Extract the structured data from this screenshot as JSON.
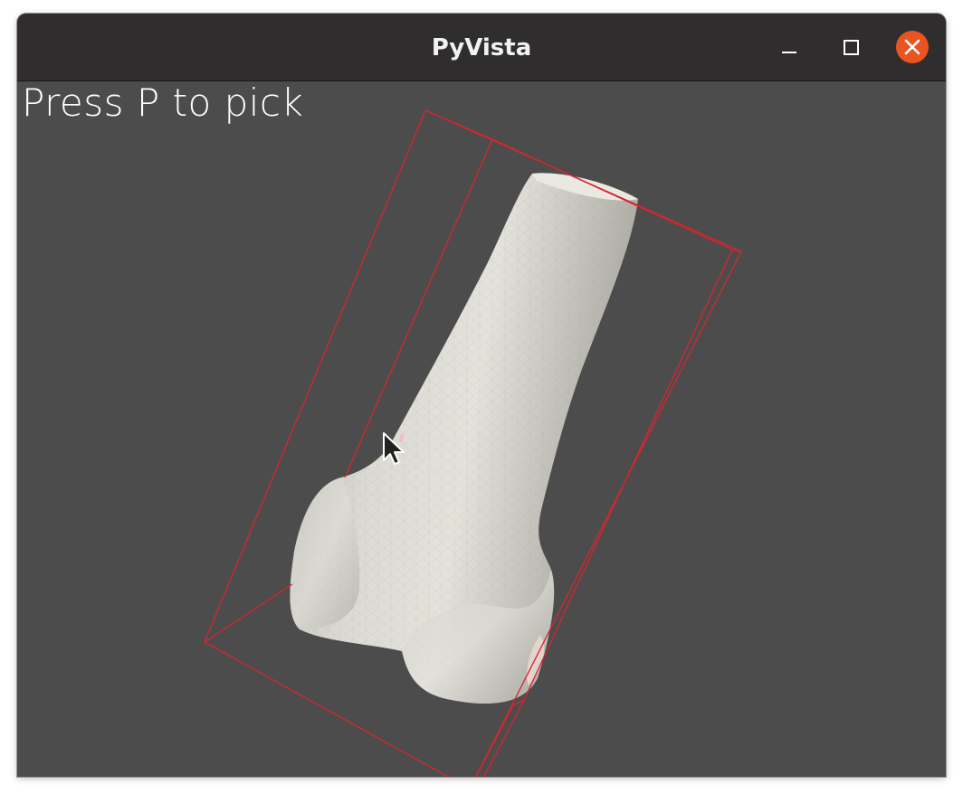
{
  "window": {
    "title": "PyVista",
    "controls": {
      "minimize": "minimize-icon",
      "maximize": "maximize-icon",
      "close": "close-icon"
    },
    "close_color": "#e95420"
  },
  "viewport": {
    "overlay_text": "Press P to pick",
    "background_color": "#4c4c4c",
    "mesh": {
      "name": "femur",
      "color": "#deddd6"
    },
    "bounding_box": {
      "color": "#d6262f"
    },
    "picked_point": {
      "color": "#f5b8c4"
    },
    "cursor": "arrow-pointer-icon"
  }
}
